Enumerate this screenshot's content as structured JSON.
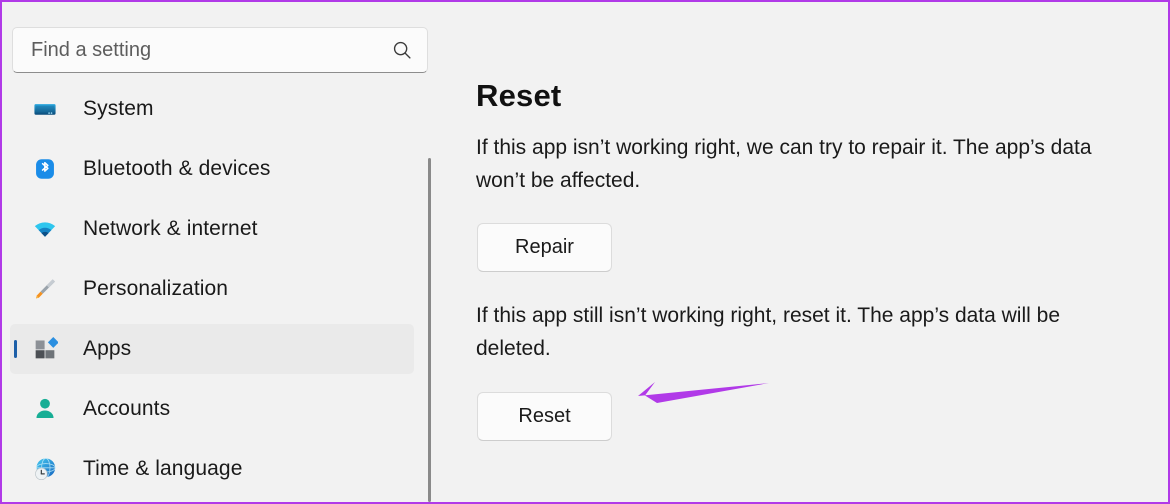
{
  "window": {
    "app": "Settings",
    "background_color": "#f2f2f2",
    "annotation_border_color": "#b13ae8"
  },
  "search": {
    "placeholder": "Find a setting",
    "value": "",
    "icon": "search-icon"
  },
  "sidebar": {
    "selected": "Apps",
    "items": [
      {
        "label": "System",
        "icon": "system-icon",
        "selected": false,
        "clipped": true
      },
      {
        "label": "Bluetooth & devices",
        "icon": "bluetooth-icon",
        "selected": false
      },
      {
        "label": "Network & internet",
        "icon": "network-icon",
        "selected": false
      },
      {
        "label": "Personalization",
        "icon": "paintbrush-icon",
        "selected": false
      },
      {
        "label": "Apps",
        "icon": "apps-icon",
        "selected": true
      },
      {
        "label": "Accounts",
        "icon": "person-icon",
        "selected": false
      },
      {
        "label": "Time & language",
        "icon": "globe-clock-icon",
        "selected": false
      }
    ],
    "scrollbar": {
      "visible": true,
      "color": "#8a8a8a"
    }
  },
  "main": {
    "title": "Reset",
    "repair_description": "If this app isn’t working right, we can try to repair it. The app’s data won’t be affected.",
    "repair_button": "Repair",
    "reset_description": "If this app still isn’t working right, reset it. The app’s data will be deleted.",
    "reset_button": "Reset"
  },
  "annotation": {
    "arrow": {
      "points_to": "reset-button",
      "direction": "left",
      "color": "#b13ae8"
    }
  }
}
